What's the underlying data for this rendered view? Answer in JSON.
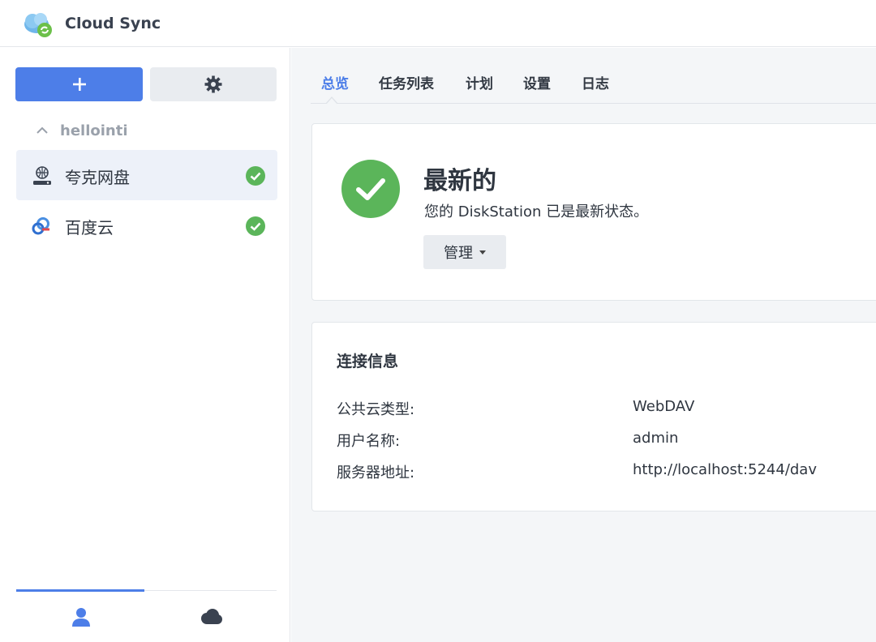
{
  "app": {
    "title": "Cloud Sync"
  },
  "sidebar": {
    "add_label": "+",
    "group_label": "hellointi",
    "items": [
      {
        "label": "夸克网盘",
        "status": "ok"
      },
      {
        "label": "百度云",
        "status": "ok"
      }
    ]
  },
  "tabs": [
    {
      "label": "总览",
      "active": true
    },
    {
      "label": "任务列表",
      "active": false
    },
    {
      "label": "计划",
      "active": false
    },
    {
      "label": "设置",
      "active": false
    },
    {
      "label": "日志",
      "active": false
    }
  ],
  "status": {
    "title": "最新的",
    "description": "您的 DiskStation 已是最新状态。",
    "manage_label": "管理"
  },
  "connection_info": {
    "title": "连接信息",
    "rows": [
      {
        "key": "公共云类型:",
        "value": "WebDAV"
      },
      {
        "key": "用户名称:",
        "value": "admin"
      },
      {
        "key": "服务器地址:",
        "value": "http://localhost:5244/dav"
      }
    ]
  },
  "colors": {
    "accent": "#4d7ee8",
    "success": "#5bb55a"
  }
}
